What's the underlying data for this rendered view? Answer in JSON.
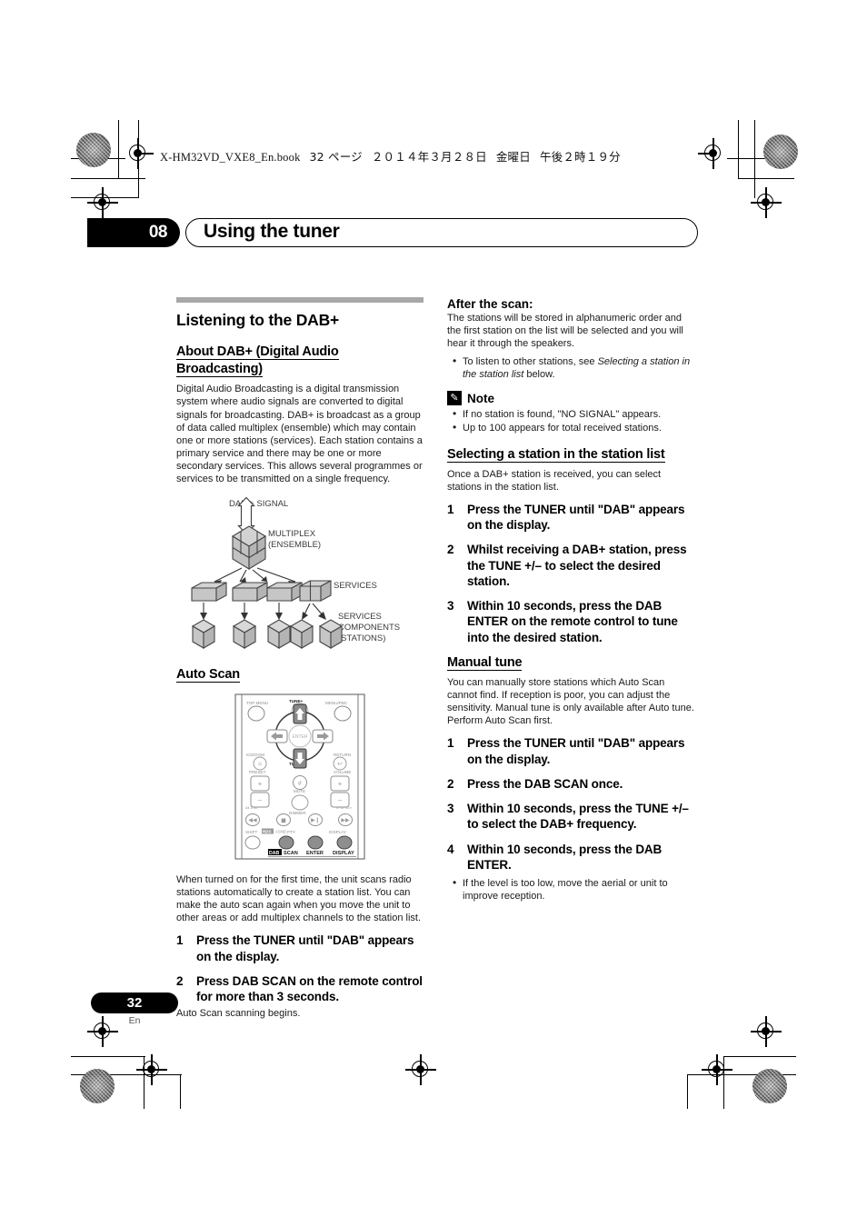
{
  "print_header": {
    "filename": "X-HM32VD_VXE8_En.book",
    "page_marker": "32 ページ",
    "date": "２０１４年３月２８日",
    "weekday": "金曜日",
    "time": "午後２時１９分"
  },
  "chapter": {
    "number": "08",
    "title": "Using the tuner"
  },
  "left_column": {
    "section_title": "Listening to the DAB+",
    "about": {
      "heading": "About DAB+ (Digital Audio Broadcasting)",
      "body": "Digital Audio Broadcasting is a digital transmission system where audio signals are converted to digital signals for broadcasting. DAB+ is broadcast as a group of data called multiplex (ensemble) which may contain one or more stations (services). Each station contains a primary service and there may be one or more secondary services. This allows several programmes or services to be transmitted on a single frequency."
    },
    "diagram": {
      "name": "dab-multiplex-diagram",
      "signal_label": "DAB + SIGNAL",
      "multiplex_label_line1": "MULTIPLEX",
      "multiplex_label_line2": "(ENSEMBLE)",
      "services_label": "SERVICES",
      "components_label_line1": "SERVICES",
      "components_label_line2": "COMPONENTS",
      "components_label_line3": "(STATIONS)"
    },
    "auto_scan": {
      "heading": "Auto Scan",
      "remote": {
        "name": "remote-control-illustration",
        "labels": {
          "top_menu": "TOP MENU",
          "tune_plus": "TUNE+",
          "menu_prec": "MENU/PBC",
          "enter": "ENTER",
          "iozoom": "IO/ZOOM",
          "tune_minus": "TUNE-",
          "return": "RETURN",
          "preset": "PRESET",
          "volume": "VOLUME",
          "mute": "MUTE",
          "dimmer": "DIMMER",
          "shift": "SHIFT",
          "rds": "RDS",
          "asnd": "ASND",
          "pty": "PTY",
          "display_small": "DISPLAY",
          "dab": "DAB",
          "scan": "SCAN",
          "enter_bottom": "ENTER",
          "display_bottom": "DISPLAY"
        }
      },
      "body": "When turned on for the first time, the unit scans radio stations automatically to create a station list. You can make the auto scan again when you move the unit to other areas or add multiplex channels to the station list.",
      "steps": [
        {
          "n": "1",
          "text": "Press the TUNER until \"DAB\" appears on the display."
        },
        {
          "n": "2",
          "text": "Press DAB SCAN on the remote control for more than 3 seconds."
        }
      ],
      "step2_note": "Auto Scan scanning begins."
    }
  },
  "right_column": {
    "after_scan": {
      "heading": "After the scan:",
      "body": "The stations will be stored in alphanumeric order and the first station on the list will be selected and you will hear it through the speakers.",
      "bullets_pre": "To listen to other stations, see ",
      "bullets_italic": "Selecting a station in the station list",
      "bullets_post": " below."
    },
    "note": {
      "icon": "pencil-note-icon",
      "label": "Note",
      "items": [
        "If no station is found, \"NO SIGNAL\" appears.",
        "Up to 100 appears for total received stations."
      ]
    },
    "selecting": {
      "heading": "Selecting a station in the station list",
      "body": "Once a DAB+ station is received, you can select stations in the station list.",
      "steps": [
        {
          "n": "1",
          "text": "Press the TUNER until \"DAB\" appears on the display."
        },
        {
          "n": "2",
          "text": "Whilst receiving a DAB+ station, press the TUNE +/– to select the desired station."
        },
        {
          "n": "3",
          "text": "Within 10 seconds, press the DAB ENTER on the remote control to tune into the desired station."
        }
      ]
    },
    "manual_tune": {
      "heading": "Manual tune",
      "body": "You can manually store stations which Auto Scan cannot find. If reception is poor, you can adjust the sensitivity. Manual tune is only available after Auto tune. Perform Auto Scan first.",
      "steps": [
        {
          "n": "1",
          "text": "Press the TUNER until \"DAB\" appears on the display."
        },
        {
          "n": "2",
          "text": "Press the DAB SCAN once."
        },
        {
          "n": "3",
          "text": "Within 10 seconds, press the TUNE +/– to select the DAB+ frequency."
        },
        {
          "n": "4",
          "text": "Within 10 seconds, press the DAB ENTER."
        }
      ],
      "bullet": "If the level is too low, move the aerial or unit to improve reception."
    }
  },
  "footer": {
    "page_number": "32",
    "language": "En"
  },
  "colors": {
    "rule_bar": "#a8a8a8",
    "ink": "#000000",
    "body_text": "#1a1a1a",
    "diagram_fill": "#cccccc",
    "diagram_stroke": "#444444"
  }
}
